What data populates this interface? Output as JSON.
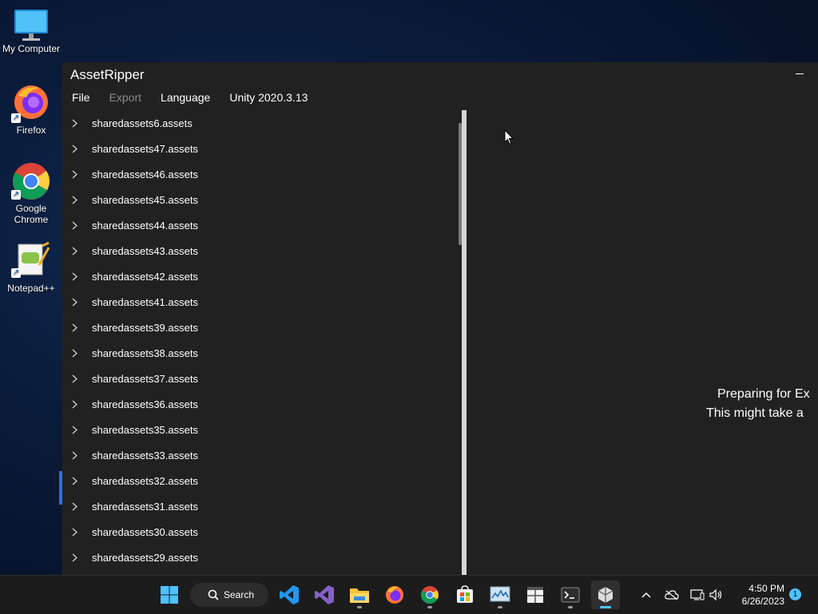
{
  "desktop": {
    "icons": [
      {
        "label": "My Computer",
        "icon": "monitor-icon"
      },
      {
        "label": "Firefox",
        "icon": "firefox-icon"
      },
      {
        "label": "Google Chrome",
        "icon": "chrome-icon"
      },
      {
        "label": "Notepad++",
        "icon": "notepadpp-icon"
      }
    ]
  },
  "window": {
    "title": "AssetRipper",
    "menu": {
      "file": "File",
      "export": "Export",
      "language": "Language",
      "version": "Unity 2020.3.13"
    },
    "tree_items": [
      "sharedassets6.assets",
      "sharedassets47.assets",
      "sharedassets46.assets",
      "sharedassets45.assets",
      "sharedassets44.assets",
      "sharedassets43.assets",
      "sharedassets42.assets",
      "sharedassets41.assets",
      "sharedassets39.assets",
      "sharedassets38.assets",
      "sharedassets37.assets",
      "sharedassets36.assets",
      "sharedassets35.assets",
      "sharedassets33.assets",
      "sharedassets32.assets",
      "sharedassets31.assets",
      "sharedassets30.assets",
      "sharedassets29.assets"
    ],
    "status": {
      "line1": "Preparing for Ex",
      "line2": "This might take a"
    }
  },
  "taskbar": {
    "search_label": "Search",
    "clock_time": "4:50 PM",
    "clock_date": "6/26/2023",
    "notification_count": "1",
    "accent": "#4cc2ff"
  }
}
